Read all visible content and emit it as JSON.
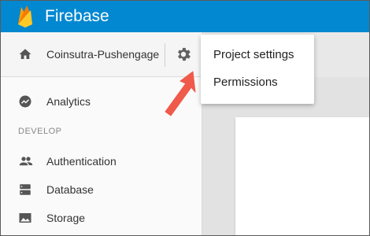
{
  "app": {
    "title": "Firebase"
  },
  "project": {
    "name": "Coinsutra-Pushengage"
  },
  "menu": {
    "items": [
      "Project settings",
      "Permissions"
    ]
  },
  "sidebar": {
    "analytics_label": "Analytics",
    "section_develop": "DEVELOP",
    "items": [
      {
        "label": "Authentication",
        "icon": "people-icon"
      },
      {
        "label": "Database",
        "icon": "database-icon"
      },
      {
        "label": "Storage",
        "icon": "image-icon"
      }
    ]
  },
  "colors": {
    "header_bg": "#0288d1",
    "arrow": "#ef5a4a"
  }
}
